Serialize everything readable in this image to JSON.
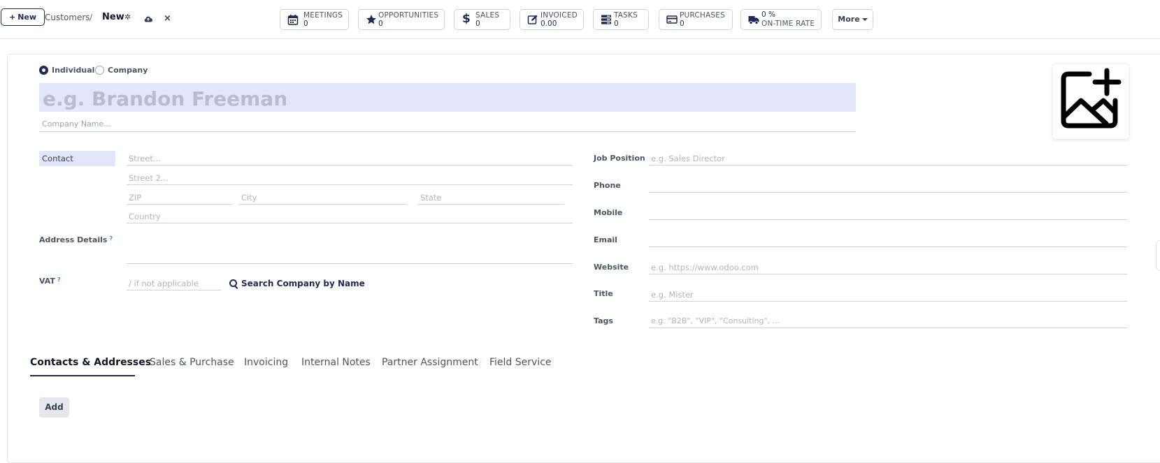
{
  "topbar": {
    "new_label": "New",
    "breadcrumb_parent": "Customers",
    "breadcrumb_sep": "/",
    "breadcrumb_current": "New",
    "more_label": "More"
  },
  "stats": [
    {
      "label": "MEETINGS",
      "value": "0",
      "icon": "calendar-icon"
    },
    {
      "label": "OPPORTUNITIES",
      "value": "0",
      "icon": "star-icon"
    },
    {
      "label": "SALES",
      "value": "0",
      "icon": "dollar-icon"
    },
    {
      "label": "INVOICED",
      "value": "0.00",
      "icon": "edit-icon"
    },
    {
      "label": "TASKS",
      "value": "0",
      "icon": "tasks-icon"
    },
    {
      "label": "PURCHASES",
      "value": "0",
      "icon": "credit-card-icon"
    },
    {
      "label": "ON-TIME RATE",
      "value": "0 %",
      "icon": "truck-icon"
    }
  ],
  "form": {
    "type_individual": "Individual",
    "type_company": "Company",
    "name_placeholder": "e.g. Brandon Freeman",
    "company_placeholder": "Company Name...",
    "contact_type": "Contact",
    "street_placeholder": "Street...",
    "street2_placeholder": "Street 2...",
    "zip_placeholder": "ZIP",
    "city_placeholder": "City",
    "state_placeholder": "State",
    "country_placeholder": "Country",
    "address_details_label": "Address Details",
    "help_mark": "?",
    "vat_label": "VAT",
    "vat_placeholder": "/ if not applicable",
    "search_company_label": "Search Company by Name",
    "job_position_label": "Job Position",
    "job_position_placeholder": "e.g. Sales Director",
    "phone_label": "Phone",
    "mobile_label": "Mobile",
    "email_label": "Email",
    "website_label": "Website",
    "website_placeholder": "e.g. https://www.odoo.com",
    "title_label": "Title",
    "title_placeholder": "e.g. Mister",
    "tags_label": "Tags",
    "tags_placeholder": "e.g. \"B2B\", \"VIP\", \"Consulting\", ..."
  },
  "tabs": [
    "Contacts & Addresses",
    "Sales & Purchase",
    "Invoicing",
    "Internal Notes",
    "Partner Assignment",
    "Field Service"
  ],
  "add_label": "Add",
  "colors": {
    "brand": "#1f2a55",
    "highlight": "#e3e5fb"
  }
}
